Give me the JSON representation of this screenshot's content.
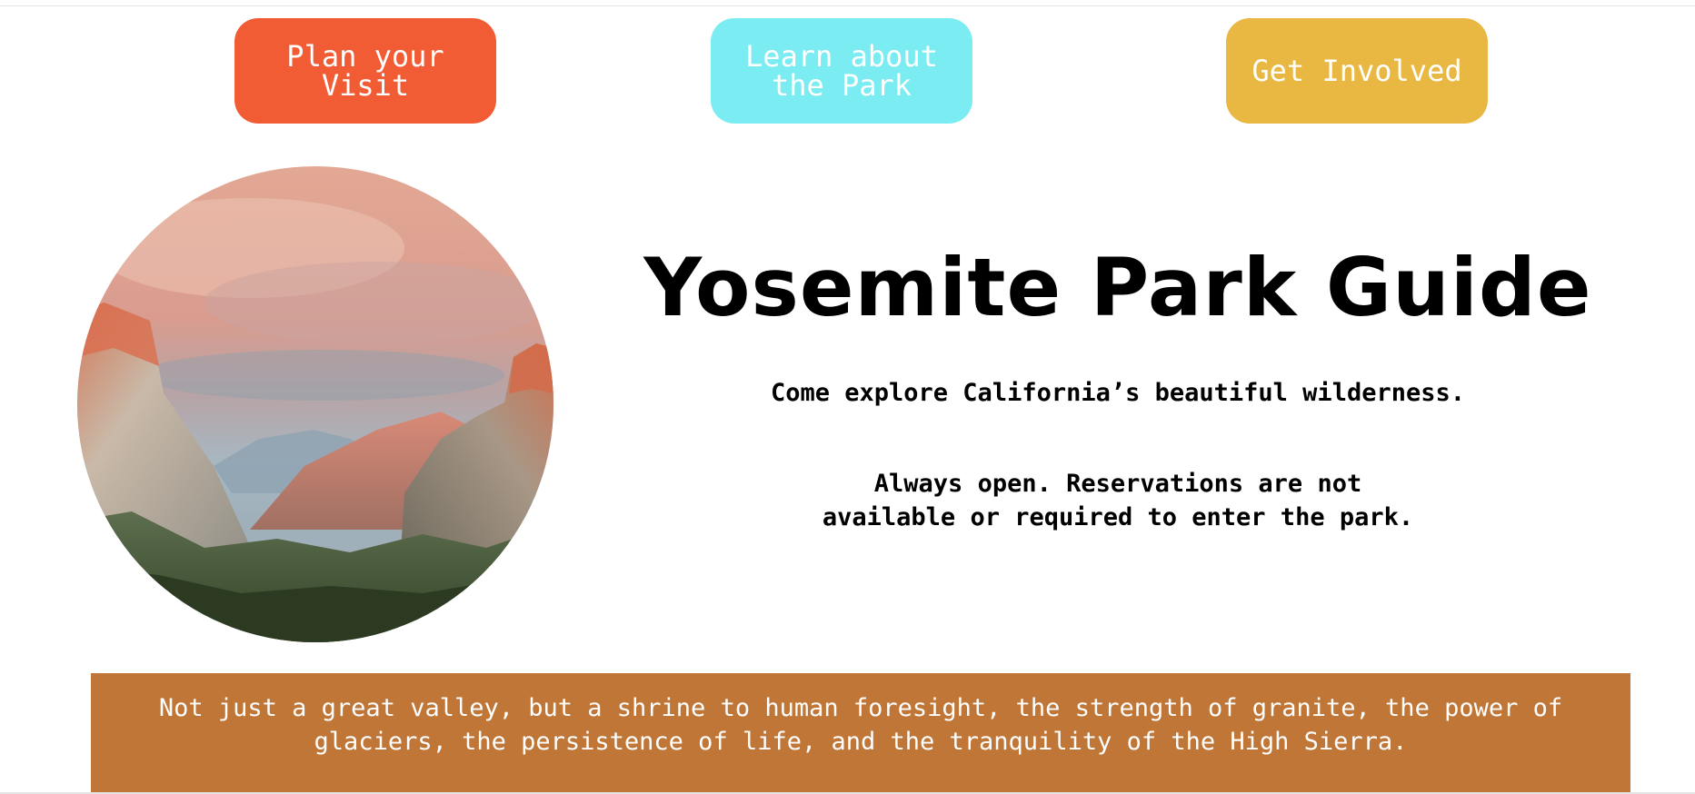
{
  "nav": {
    "plan_label": "Plan your Visit",
    "learn_label": "Learn about the Park",
    "involved_label": "Get Involved",
    "plan_color": "#f15c35",
    "learn_color": "#7aecf2",
    "involved_color": "#e9b843"
  },
  "hero": {
    "image_icon": "yosemite-valley-photo"
  },
  "header": {
    "title": "Yosemite Park Guide",
    "subtitle": "Come explore California’s beautiful wilderness.",
    "hours": "Always open. Reservations are not available or required to enter the park."
  },
  "quote": {
    "text": "Not just a great valley, but a shrine to human foresight, the strength of granite, the power of glaciers, the persistence of life, and the tranquility of the High Sierra.",
    "band_color": "#bf7637"
  }
}
